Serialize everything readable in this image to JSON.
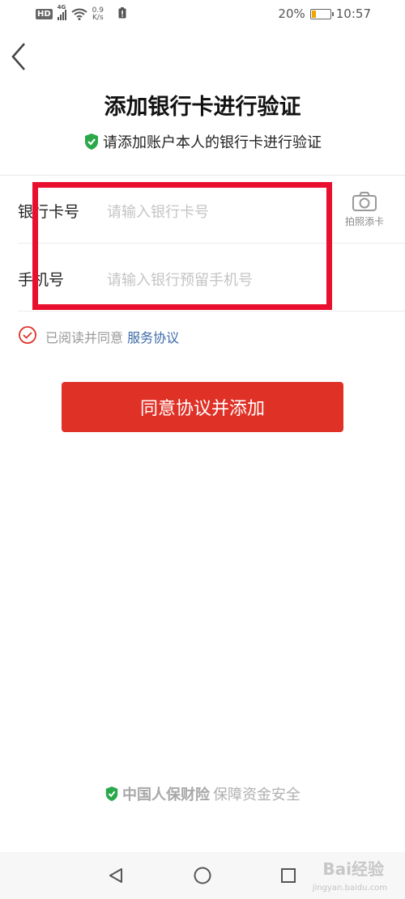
{
  "status_bar": {
    "network_badge": "HD",
    "network_type": "4G",
    "speed_value": "0.9",
    "speed_unit": "K/s",
    "battery_percent_text": "20%",
    "battery_level": 0.2,
    "time": "10:57"
  },
  "header": {
    "title": "添加银行卡进行验证",
    "subtitle": "请添加账户本人的银行卡进行验证"
  },
  "form": {
    "card_label": "银行卡号",
    "card_placeholder": "请输入银行卡号",
    "phone_label": "手机号",
    "phone_placeholder": "请输入银行预留手机号",
    "photo_button_label": "拍照添卡"
  },
  "agreement": {
    "prefix": "已阅读并同意",
    "link": "服务协议"
  },
  "primary_button": "同意协议并添加",
  "footer": {
    "brand": "中国人保财险",
    "slogan": "保障资金安全"
  },
  "watermark": {
    "main": "Bai经验",
    "sub": "jingyan.baidu.com"
  },
  "colors": {
    "primary": "#e03127",
    "shield_green": "#2aa84a",
    "link": "#3d6aa8",
    "highlight": "#e8102e"
  }
}
